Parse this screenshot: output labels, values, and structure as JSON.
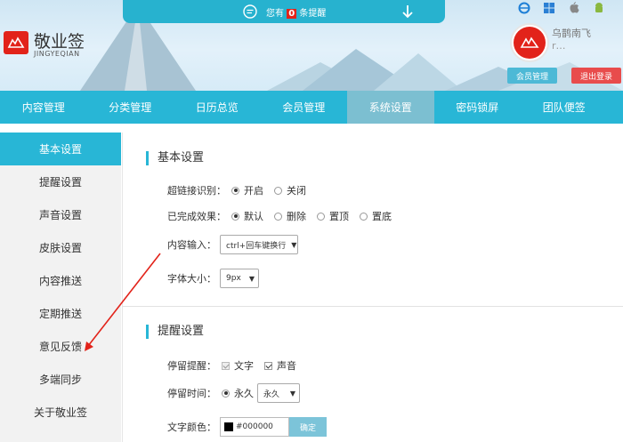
{
  "app": {
    "logo_text": "敬业签",
    "logo_sub": "JINGYEQIAN"
  },
  "notify": {
    "prefix": "您有",
    "count": "0",
    "suffix": "条提醒"
  },
  "user": {
    "name": "乌鹊南飞",
    "sub": "r…"
  },
  "header_buttons": {
    "member": "会员管理",
    "logout": "退出登录"
  },
  "nav": [
    {
      "label": "内容管理"
    },
    {
      "label": "分类管理"
    },
    {
      "label": "日历总览"
    },
    {
      "label": "会员管理"
    },
    {
      "label": "系统设置"
    },
    {
      "label": "密码锁屏"
    },
    {
      "label": "团队便签"
    }
  ],
  "sidebar": [
    {
      "label": "基本设置"
    },
    {
      "label": "提醒设置"
    },
    {
      "label": "声音设置"
    },
    {
      "label": "皮肤设置"
    },
    {
      "label": "内容推送"
    },
    {
      "label": "定期推送"
    },
    {
      "label": "意见反馈"
    },
    {
      "label": "多端同步"
    },
    {
      "label": "关于敬业签"
    }
  ],
  "basic": {
    "title": "基本设置",
    "link_label": "超链接识别：",
    "link_on": "开启",
    "link_off": "关闭",
    "done_label": "已完成效果：",
    "done_opts": [
      "默认",
      "删除",
      "置顶",
      "置底"
    ],
    "input_label": "内容输入：",
    "input_value": "ctrl+回车键换行",
    "font_label": "字体大小：",
    "font_value": "9px"
  },
  "remind": {
    "title": "提醒设置",
    "stay_label": "停留提醒：",
    "stay_text": "文字",
    "stay_sound": "声音",
    "time_label": "停留时间：",
    "time_radio": "永久",
    "time_value": "永久",
    "color_label": "文字颜色：",
    "color_value": "#000000",
    "ok": "确定"
  },
  "colors": {
    "accent": "#28b6d6",
    "active_nav": "#7cbfd1",
    "brand_red": "#e2231a"
  }
}
